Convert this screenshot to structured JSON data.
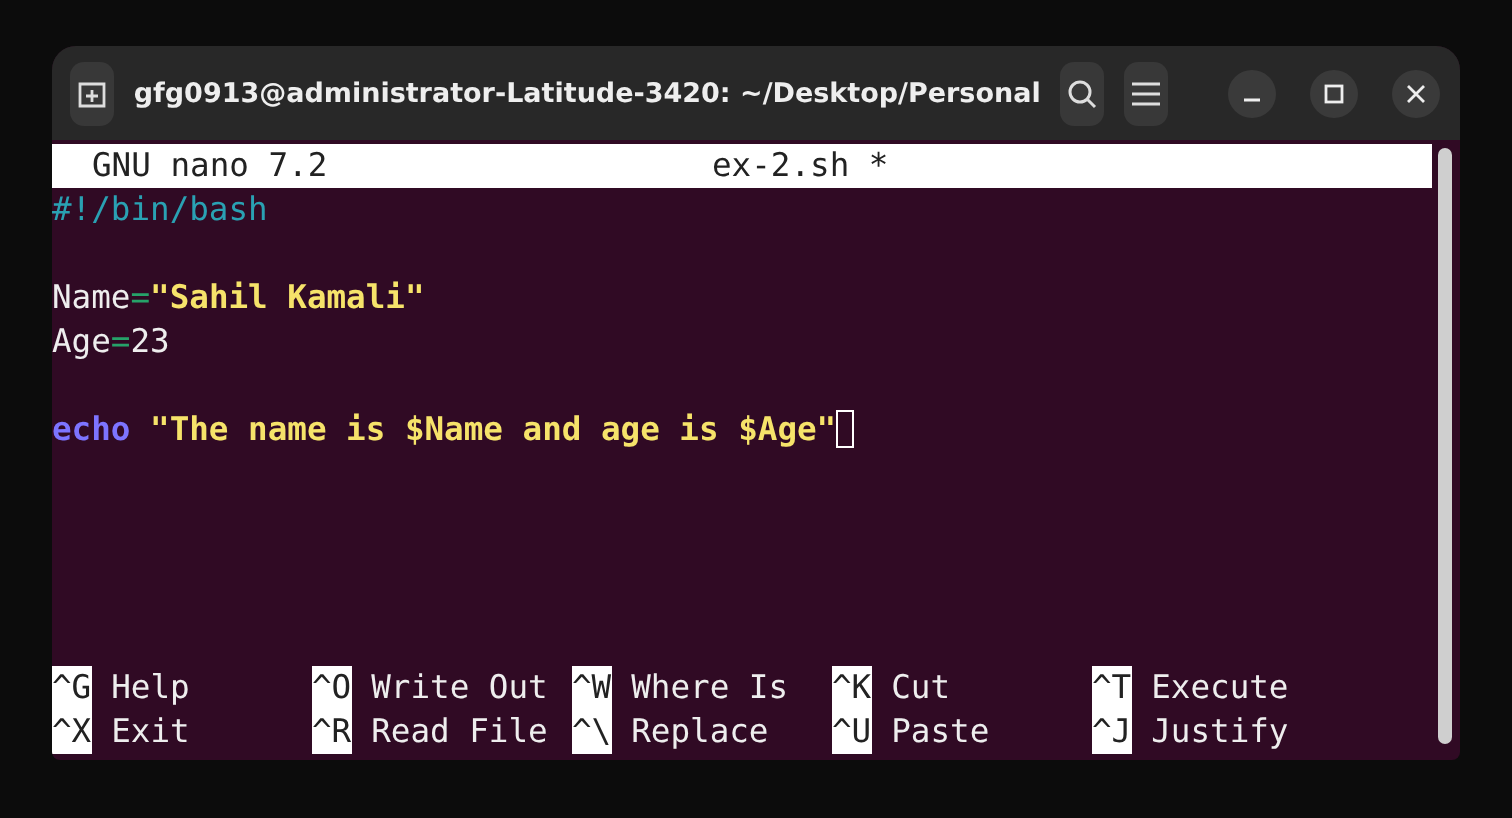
{
  "window": {
    "title": "gfg0913@administrator-Latitude-3420: ~/Desktop/Personal"
  },
  "nano": {
    "version": "GNU nano 7.2",
    "filename": "ex-2.sh *"
  },
  "lines": [
    {
      "tokens": [
        {
          "text": "#!/bin/bash",
          "kind": "comment"
        }
      ]
    },
    {
      "kind": "blank"
    },
    {
      "tokens": [
        {
          "text": "Name",
          "kind": "plain"
        },
        {
          "text": "=",
          "kind": "operator"
        },
        {
          "text": "\"Sahil Kamali\"",
          "kind": "string"
        }
      ]
    },
    {
      "tokens": [
        {
          "text": "Age",
          "kind": "plain"
        },
        {
          "text": "=",
          "kind": "operator"
        },
        {
          "text": "23",
          "kind": "plain"
        }
      ]
    },
    {
      "kind": "blank"
    },
    {
      "tokens": [
        {
          "text": "echo",
          "kind": "keyword"
        },
        {
          "text": " \"The name is $Name and age is $Age\"",
          "kind": "string"
        }
      ],
      "cursor": true
    }
  ],
  "shortcuts": [
    {
      "key": "^G",
      "label": "Help"
    },
    {
      "key": "^O",
      "label": "Write Out"
    },
    {
      "key": "^W",
      "label": "Where Is"
    },
    {
      "key": "^K",
      "label": "Cut"
    },
    {
      "key": "^T",
      "label": "Execute"
    },
    {
      "key": "^X",
      "label": "Exit"
    },
    {
      "key": "^R",
      "label": "Read File"
    },
    {
      "key": "^\\",
      "label": "Replace"
    },
    {
      "key": "^U",
      "label": "Paste"
    },
    {
      "key": "^J",
      "label": "Justify"
    }
  ]
}
